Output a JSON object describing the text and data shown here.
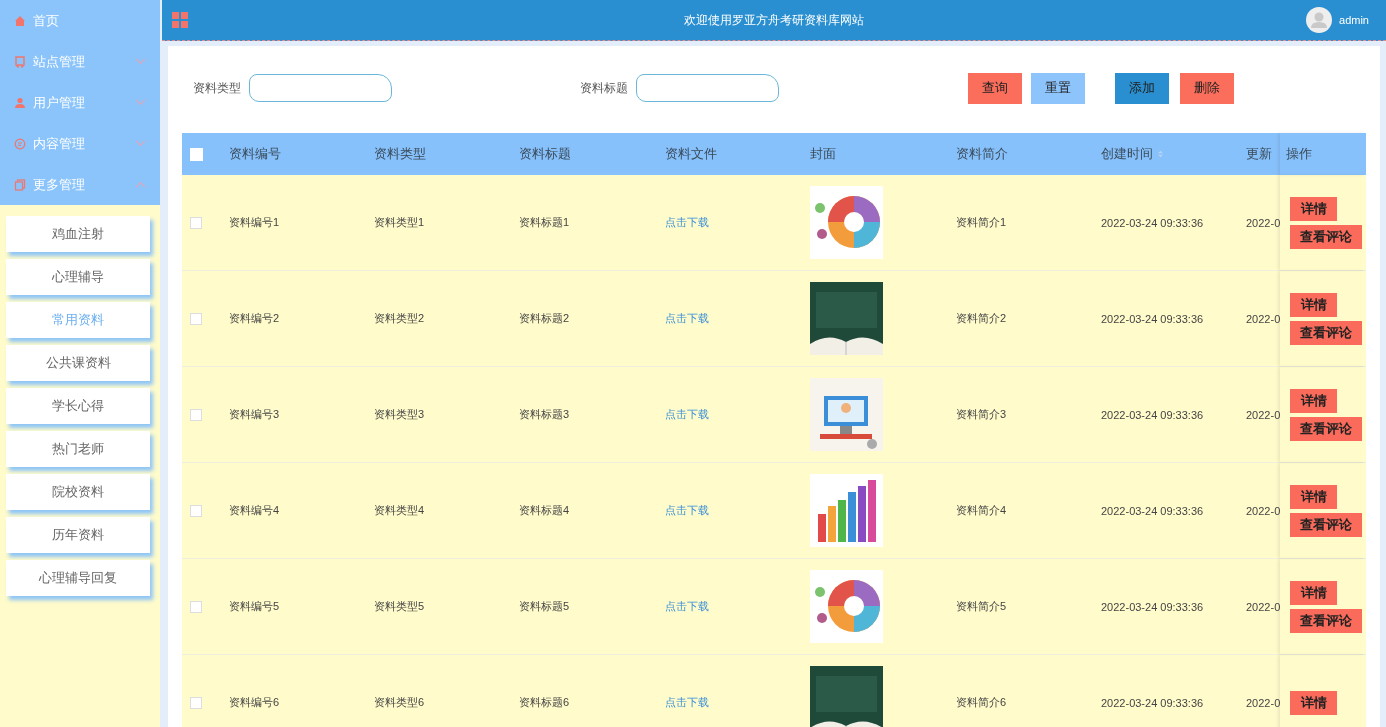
{
  "sidebar": {
    "menu": [
      {
        "label": "首页"
      },
      {
        "label": "站点管理",
        "expanded": false
      },
      {
        "label": "用户管理",
        "expanded": false
      },
      {
        "label": "内容管理",
        "expanded": false
      },
      {
        "label": "更多管理",
        "expanded": true
      }
    ],
    "submenu": [
      {
        "label": "鸡血注射",
        "selected": false
      },
      {
        "label": "心理辅导",
        "selected": false
      },
      {
        "label": "常用资料",
        "selected": true
      },
      {
        "label": "公共课资料",
        "selected": false
      },
      {
        "label": "学长心得",
        "selected": false
      },
      {
        "label": "热门老师",
        "selected": false
      },
      {
        "label": "院校资料",
        "selected": false
      },
      {
        "label": "历年资料",
        "selected": false
      },
      {
        "label": "心理辅导回复",
        "selected": false
      }
    ]
  },
  "header": {
    "title": "欢迎使用罗亚方舟考研资料库网站",
    "user": "admin"
  },
  "filters": [
    {
      "label": "资料类型"
    },
    {
      "label": "资料标题"
    }
  ],
  "buttons": [
    {
      "label": "查询",
      "kind": "search"
    },
    {
      "label": "重置",
      "kind": "reset"
    },
    {
      "label": "添加",
      "kind": "add"
    },
    {
      "label": "删除",
      "kind": "delete"
    }
  ],
  "table": {
    "select_all": {
      "checked": false
    },
    "columns": [
      "资料编号",
      "资料类型",
      "资料标题",
      "资料文件",
      "封面",
      "资料简介",
      "创建时间",
      "更新",
      "操作"
    ],
    "rows": [
      {
        "checked": false,
        "id": "资料编号1",
        "type": "资料类型1",
        "title": "资料标题1",
        "file": "点击下载",
        "cover": {
          "kind": "picture"
        },
        "intro": "资料简介1",
        "created": "2022-03-24 09:33:36",
        "updated": "2022-0",
        "actions": [
          "详情",
          "查看评论"
        ]
      },
      {
        "checked": false,
        "id": "资料编号2",
        "type": "资料类型2",
        "title": "资料标题2",
        "file": "点击下载",
        "cover": {
          "kind": "picture"
        },
        "intro": "资料简介2",
        "created": "2022-03-24 09:33:36",
        "updated": "2022-0",
        "actions": [
          "详情",
          "查看评论"
        ]
      },
      {
        "checked": false,
        "id": "资料编号3",
        "type": "资料类型3",
        "title": "资料标题3",
        "file": "点击下载",
        "cover": {
          "kind": "picture"
        },
        "intro": "资料简介3",
        "created": "2022-03-24 09:33:36",
        "updated": "2022-0",
        "actions": [
          "详情",
          "查看评论"
        ]
      },
      {
        "checked": false,
        "id": "资料编号4",
        "type": "资料类型4",
        "title": "资料标题4",
        "file": "点击下载",
        "cover": {
          "kind": "picture"
        },
        "intro": "资料简介4",
        "created": "2022-03-24 09:33:36",
        "updated": "2022-0",
        "actions": [
          "详情",
          "查看评论"
        ]
      },
      {
        "checked": false,
        "id": "资料编号5",
        "type": "资料类型5",
        "title": "资料标题5",
        "file": "点击下载",
        "cover": {
          "kind": "picture"
        },
        "intro": "资料简介5",
        "created": "2022-03-24 09:33:36",
        "updated": "2022-0",
        "actions": [
          "详情",
          "查看评论"
        ]
      },
      {
        "checked": false,
        "id": "资料编号6",
        "type": "资料类型6",
        "title": "资料标题6",
        "file": "点击下载",
        "cover": {
          "kind": "picture"
        },
        "intro": "资料简介6",
        "created": "2022-03-24 09:33:36",
        "updated": "2022-0",
        "actions": [
          "详情"
        ]
      }
    ]
  }
}
